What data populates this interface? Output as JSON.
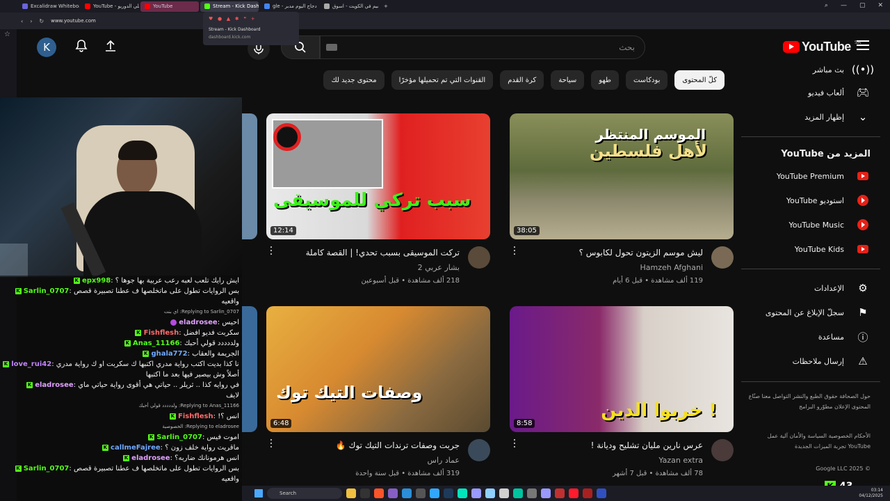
{
  "browser": {
    "tabs": [
      {
        "label": "Excalidraw Whiteboard",
        "color": "#6965db"
      },
      {
        "label": "YouTube - حلي الدوريو",
        "color": "#ff0000"
      },
      {
        "label": "YouTube",
        "color": "#ff0000"
      },
      {
        "label": "Stream - Kick Dashbo",
        "color": "#53fc18"
      },
      {
        "label": "gle - بحث - دجاج اليوم مدبر",
        "color": "#4285f4"
      },
      {
        "label": "اسوق التسيم في الكويت - اسوق",
        "color": "#aaaaaa"
      }
    ],
    "url": "www.youtube.com",
    "tab_tooltip": {
      "title": "Stream - Kick Dashboard",
      "url": "dashboard.kick.com"
    }
  },
  "header": {
    "avatar_letter": "K",
    "search_placeholder": "بحث",
    "logo_text": "YouTube",
    "country": "SA"
  },
  "chips": [
    "كلّ المحتوى",
    "بودكاست",
    "طهو",
    "سياحة",
    "كرة القدم",
    "القنوات التي تم تحميلها مؤخرًا",
    "محتوى جديد لك"
  ],
  "guide": {
    "top_items": [
      {
        "label": "بث مباشر",
        "icon": "live-icon"
      },
      {
        "label": "ألعاب فيديو",
        "icon": "gaming-icon"
      },
      {
        "label": "إظهار المزيد",
        "icon": "chevron-down-icon"
      }
    ],
    "more_title": "المزيد من YouTube",
    "more_items": [
      {
        "label": "YouTube Premium"
      },
      {
        "label": "استوديو YouTube"
      },
      {
        "label": "YouTube Music"
      },
      {
        "label": "YouTube Kids"
      }
    ],
    "settings_items": [
      {
        "label": "الإعدادات",
        "icon": "gear-icon"
      },
      {
        "label": "سجلّ الإبلاغ عن المحتوى",
        "icon": "flag-icon"
      },
      {
        "label": "مساعدة",
        "icon": "help-icon"
      },
      {
        "label": "إرسال ملاحظات",
        "icon": "feedback-icon"
      }
    ],
    "footer1": "حول  الصحافة  حقوق الطبع والنشر  التواصل معنا  صنّاع المحتوى  الإعلان  مطوّرو البرامج",
    "footer2": "الأحكام  الخصوصية  السياسة والأمان  آلية عمل YouTube  تجربة الميزات الجديدة",
    "copyright": "© 2025 Google LLC"
  },
  "videos": [
    {
      "thumb_text": "لأهل فلسطين",
      "thumb_sub": "الموسم المنتظر",
      "duration": "38:05",
      "title": "ليش موسم الزيتون تحول لكابوس ؟",
      "channel": "Hamzeh Afghani",
      "stats": "119 ألف مشاهدة • قبل 6 أيام"
    },
    {
      "thumb_text": "سبب تركي للموسيقى",
      "thumb_sub": "",
      "duration": "12:14",
      "title": "تركت الموسيقى بسبب تحدي! | القصة كاملة",
      "channel": "بشار عربي 2",
      "stats": "218 ألف مشاهدة • قبل أسبوعين"
    },
    {
      "thumb_text": "خربوا الدين !",
      "thumb_sub": "",
      "duration": "8:58",
      "title": "عرس نارين مليان تشليح وديانة !",
      "channel": "Yazan extra",
      "stats": "78 ألف مشاهدة • قبل 7 أشهر"
    },
    {
      "thumb_text": "وصفات التيك توك",
      "thumb_sub": "",
      "duration": "6:48",
      "title": "جربت وصفات ترندات التيك توك 🔥",
      "channel": "عماد راس",
      "stats": "319 ألف مشاهدة • قبل سنة واحدة"
    }
  ],
  "chat": [
    {
      "user": "epx998",
      "color": "#53fc18",
      "text": "ايش رايك تلعب لعبه رعب عربية بها جوها ؟",
      "badge": "k"
    },
    {
      "user": "Sarlin_0707",
      "color": "#53fc18",
      "text": "بس الروايات تطول على ماتخلصها ف عطنا تصبيرة قصص",
      "badge": "k"
    },
    {
      "cont": "واقعيه"
    },
    {
      "reply": "Replying to Sarlin_0707: اي بنت"
    },
    {
      "user": "eladrosee",
      "color": "#e0a0ff",
      "text": "احيس",
      "badge": "p"
    },
    {
      "user": "Fishflesh",
      "color": "#ff6b6b",
      "text": "سكربت فديو افضل",
      "badge": "k"
    },
    {
      "user": "Anas_11166",
      "color": "#53fc18",
      "text": "ولددددد قولي أحبك",
      "badge": "k"
    },
    {
      "user": "ghala772",
      "color": "#6fa8ff",
      "text": "الجريمة والعقاب",
      "badge": "k"
    },
    {
      "user": "love_rui42",
      "color": "#c084fc",
      "text": "أنا كذا بديت اكتب رواية مدري اكتبها ك سكربت او ك رواية مدري",
      "badge": "k"
    },
    {
      "cont": "أصلاً وش بيصير فيها بعد ما اكتبها"
    },
    {
      "user": "eladrosee",
      "color": "#e0a0ff",
      "text": "في روايه كذا .. ثريلر .. حياتي هي أقوى رواية حياتي ماي",
      "badge": "k"
    },
    {
      "cont": "لايف"
    },
    {
      "reply": "Replying to Anas_11166: ولددددد قولي أحبك"
    },
    {
      "user": "Fishflesh",
      "color": "#ff6b6b",
      "text": "!انس ؟",
      "badge": "k"
    },
    {
      "reply": "Replying to eladrosee: الخصوصية"
    },
    {
      "user": "Sarlin_0707",
      "color": "#53fc18",
      "text": "اموت فيس",
      "badge": "k"
    },
    {
      "user": "callmeFajree",
      "color": "#6fa8ff",
      "text": "ماقريت رواية خلف زون ؟",
      "badge": "k"
    },
    {
      "user": "eladrosee",
      "color": "#e0a0ff",
      "text": "انس هرمونانك ضاربه؟",
      "badge": "k"
    },
    {
      "user": "Sarlin_0707",
      "color": "#53fc18",
      "text": "بس الروايات تطول على ماتخلصها ف عطنا تصبيرة قصص",
      "badge": "k"
    },
    {
      "cont": "واقعيه"
    }
  ],
  "kick_viewers": "43",
  "taskbar": {
    "search_label": "Search",
    "time": "03:14",
    "date": "04/12/2025"
  }
}
